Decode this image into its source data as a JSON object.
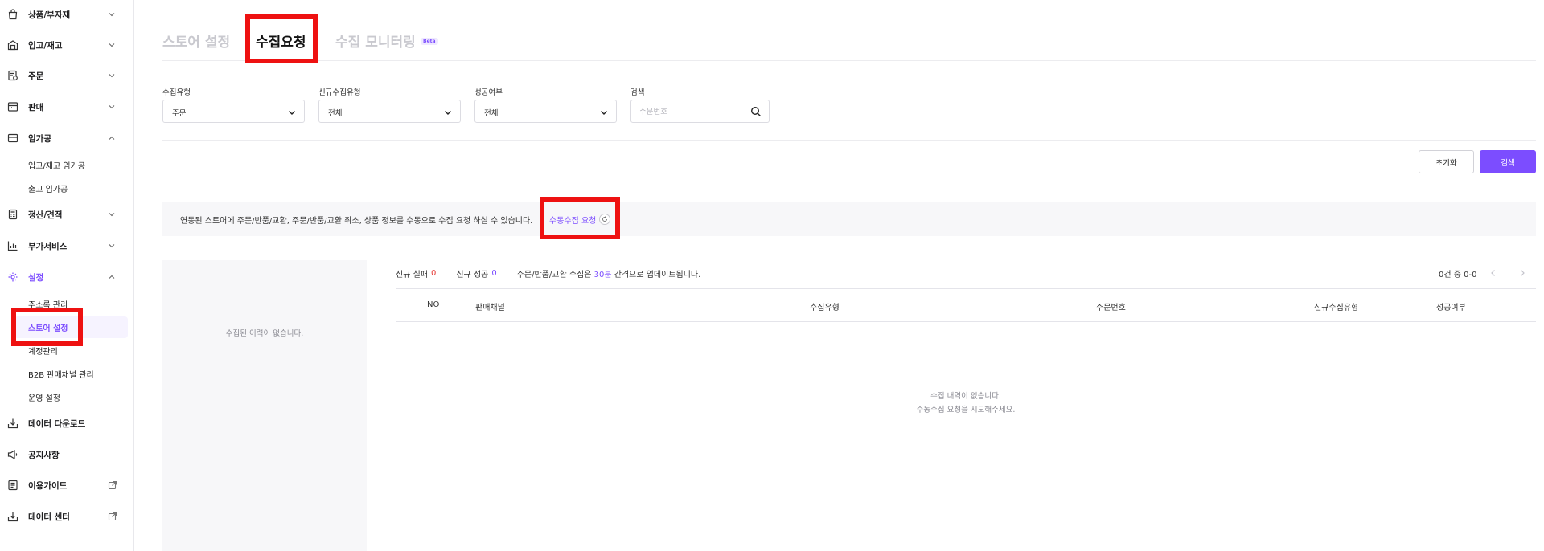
{
  "sidebar": {
    "items": [
      {
        "label": "상품/부자재",
        "icon": "bag-icon",
        "expanded": false
      },
      {
        "label": "입고/재고",
        "icon": "warehouse-icon",
        "expanded": false
      },
      {
        "label": "주문",
        "icon": "order-icon",
        "expanded": false
      },
      {
        "label": "판매",
        "icon": "sales-icon",
        "expanded": false
      },
      {
        "label": "임가공",
        "icon": "package-icon",
        "expanded": true
      },
      {
        "label": "정산/견적",
        "icon": "calculator-icon",
        "expanded": false
      },
      {
        "label": "부가서비스",
        "icon": "chart-icon",
        "expanded": false
      },
      {
        "label": "설정",
        "icon": "gear-icon",
        "expanded": true
      },
      {
        "label": "데이터 다운로드",
        "icon": "download-icon"
      },
      {
        "label": "공지사항",
        "icon": "megaphone-icon"
      },
      {
        "label": "이용가이드",
        "icon": "guide-icon"
      },
      {
        "label": "데이터 센터",
        "icon": "data-center-icon"
      }
    ],
    "processing_sub": [
      "입고/재고 임가공",
      "출고 임가공"
    ],
    "settings_sub": [
      "주소록 관리",
      "스토어 설정",
      "계정관리",
      "B2B 판매채널 관리",
      "운영 설정"
    ]
  },
  "tabs": [
    {
      "label": "스토어 설정",
      "active": false
    },
    {
      "label": "수집요청",
      "active": true
    },
    {
      "label": "수집 모니터링",
      "active": false,
      "badge": "Beta"
    }
  ],
  "filters": {
    "collect_type": {
      "label": "수집유형",
      "value": "주문"
    },
    "new_collect_type": {
      "label": "신규수집유형",
      "value": "전체"
    },
    "success": {
      "label": "성공여부",
      "value": "전체"
    },
    "search": {
      "label": "검색",
      "placeholder": "주문번호"
    }
  },
  "buttons": {
    "reset": "초기화",
    "search": "검색"
  },
  "info": {
    "text": "연동된 스토어에 주문/반품/교환, 주문/반품/교환 취소, 상품 정보를 수동으로 수집 요청 하실 수 있습니다.",
    "manual_request": "수동수집 요청"
  },
  "history": {
    "empty": "수집된 이력이 없습니다."
  },
  "stats": {
    "new_fail_label": "신규 실패",
    "new_fail_count": "0",
    "new_success_label": "신규 성공",
    "new_success_count": "0",
    "interval_prefix": "주문/반품/교환 수집은",
    "interval_value": "30분",
    "interval_suffix": "간격으로 업데이트됩니다."
  },
  "pager": {
    "text": "0건 중 0-0"
  },
  "table": {
    "headers": [
      "NO",
      "판매채널",
      "수집유형",
      "주문번호",
      "신규수집유형",
      "성공여부"
    ],
    "empty_line1": "수집 내역이 없습니다.",
    "empty_line2": "수동수집 요청을 시도해주세요."
  },
  "colors": {
    "accent": "#7c4dff",
    "highlight": "#ee1111",
    "fail": "#e53935"
  }
}
